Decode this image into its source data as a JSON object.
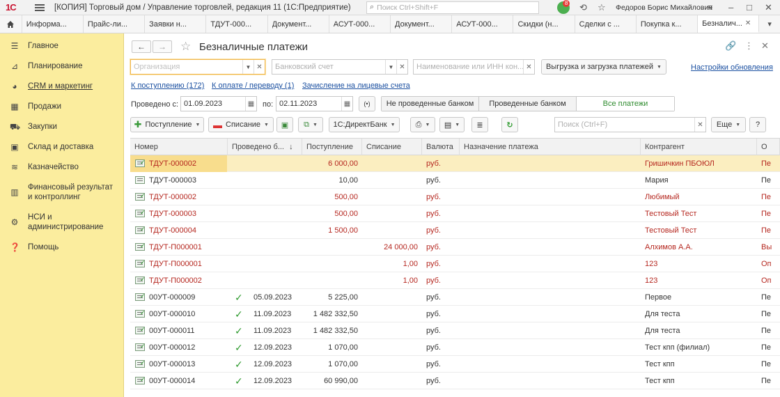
{
  "titlebar": {
    "logo": "1С",
    "title": "[КОПИЯ] Торговый дом / Управление торговлей, редакция 11  (1С:Предприятие)",
    "search_placeholder": "Поиск Ctrl+Shift+F",
    "notification_count": "8",
    "user": "Федоров Борис Михайлович"
  },
  "tabs": [
    {
      "label": "Информа..."
    },
    {
      "label": "Прайс-ли..."
    },
    {
      "label": "Заявки н..."
    },
    {
      "label": "ТДУТ-000..."
    },
    {
      "label": "Документ..."
    },
    {
      "label": "АСУТ-000..."
    },
    {
      "label": "Документ..."
    },
    {
      "label": "АСУТ-000..."
    },
    {
      "label": "Скидки (н..."
    },
    {
      "label": "Сделки с ..."
    },
    {
      "label": "Покупка к..."
    },
    {
      "label": "Безналич..."
    }
  ],
  "sidebar": {
    "items": [
      {
        "label": "Главное"
      },
      {
        "label": "Планирование"
      },
      {
        "label": "CRM и маркетинг"
      },
      {
        "label": "Продажи"
      },
      {
        "label": "Закупки"
      },
      {
        "label": "Склад и доставка"
      },
      {
        "label": "Казначейство"
      },
      {
        "label": "Финансовый результат и контроллинг"
      },
      {
        "label": "НСИ и администрирование"
      },
      {
        "label": "Помощь"
      }
    ]
  },
  "page": {
    "title": "Безналичные платежи",
    "filters": {
      "org_placeholder": "Организация",
      "bank_placeholder": "Банковский счет",
      "inn_placeholder": "Наименование или ИНН кон...",
      "upload_button": "Выгрузка и загрузка платежей",
      "settings_link": "Настройки обновления"
    },
    "links": {
      "incoming": "К поступлению (172)",
      "to_pay": "К оплате / переводу (1)",
      "personal": "Зачисление на лицевые счета"
    },
    "period": {
      "from_label": "Проведено с:",
      "from_value": "01.09.2023",
      "to_label": "по:",
      "to_value": "02.11.2023"
    },
    "segments": [
      "Не проведенные банком",
      "Проведенные банком",
      "Все платежи"
    ],
    "toolbar": {
      "incoming_button": "Поступление",
      "outgoing_button": "Списание",
      "direct_bank": "1С:ДиректБанк",
      "search_placeholder": "Поиск (Ctrl+F)",
      "more_button": "Еще",
      "help_button": "?"
    },
    "table": {
      "columns": [
        "Номер",
        "Проведено б...",
        "Поступление",
        "Списание",
        "Валюта",
        "Назначение платежа",
        "Контрагент",
        "О"
      ],
      "rows": [
        {
          "num": "ТДУТ-000002",
          "date": "",
          "in": "6 000,00",
          "out": "",
          "cur": "руб.",
          "purpose": "",
          "party": "Гришичкин ПБОЮЛ",
          "o": "Пе",
          "red": true,
          "check": false
        },
        {
          "num": "ТДУТ-000003",
          "date": "",
          "in": "10,00",
          "out": "",
          "cur": "руб.",
          "purpose": "",
          "party": "Мария",
          "o": "Пе",
          "red": false,
          "check": false
        },
        {
          "num": "ТДУТ-000002",
          "date": "",
          "in": "500,00",
          "out": "",
          "cur": "руб.",
          "purpose": "",
          "party": "Любимый",
          "o": "Пе",
          "red": true,
          "check": false
        },
        {
          "num": "ТДУТ-000003",
          "date": "",
          "in": "500,00",
          "out": "",
          "cur": "руб.",
          "purpose": "",
          "party": "Тестовый Тест",
          "o": "Пе",
          "red": true,
          "check": false
        },
        {
          "num": "ТДУТ-000004",
          "date": "",
          "in": "1 500,00",
          "out": "",
          "cur": "руб.",
          "purpose": "",
          "party": "Тестовый Тест",
          "o": "Пе",
          "red": true,
          "check": false
        },
        {
          "num": "ТДУТ-П000001",
          "date": "",
          "in": "",
          "out": "24 000,00",
          "cur": "руб.",
          "purpose": "",
          "party": "Алхимов А.А.",
          "o": "Вы",
          "red": true,
          "check": false
        },
        {
          "num": "ТДУТ-П000001",
          "date": "",
          "in": "",
          "out": "1,00",
          "cur": "руб.",
          "purpose": "",
          "party": "123",
          "o": "Оп",
          "red": true,
          "check": false
        },
        {
          "num": "ТДУТ-П000002",
          "date": "",
          "in": "",
          "out": "1,00",
          "cur": "руб.",
          "purpose": "",
          "party": "123",
          "o": "Оп",
          "red": true,
          "check": false
        },
        {
          "num": "00УТ-000009",
          "date": "05.09.2023",
          "in": "5 225,00",
          "out": "",
          "cur": "руб.",
          "purpose": "",
          "party": "Первое",
          "o": "Пе",
          "red": false,
          "check": true
        },
        {
          "num": "00УТ-000010",
          "date": "11.09.2023",
          "in": "1 482 332,50",
          "out": "",
          "cur": "руб.",
          "purpose": "",
          "party": "Для теста",
          "o": "Пе",
          "red": false,
          "check": true
        },
        {
          "num": "00УТ-000011",
          "date": "11.09.2023",
          "in": "1 482 332,50",
          "out": "",
          "cur": "руб.",
          "purpose": "",
          "party": "Для теста",
          "o": "Пе",
          "red": false,
          "check": true
        },
        {
          "num": "00УТ-000012",
          "date": "12.09.2023",
          "in": "1 070,00",
          "out": "",
          "cur": "руб.",
          "purpose": "",
          "party": "Тест кпп (филиал)",
          "o": "Пе",
          "red": false,
          "check": true
        },
        {
          "num": "00УТ-000013",
          "date": "12.09.2023",
          "in": "1 070,00",
          "out": "",
          "cur": "руб.",
          "purpose": "",
          "party": "Тест кпп",
          "o": "Пе",
          "red": false,
          "check": true
        },
        {
          "num": "00УТ-000014",
          "date": "12.09.2023",
          "in": "60 990,00",
          "out": "",
          "cur": "руб.",
          "purpose": "",
          "party": "Тест кпп",
          "o": "Пе",
          "red": false,
          "check": true
        }
      ]
    }
  }
}
